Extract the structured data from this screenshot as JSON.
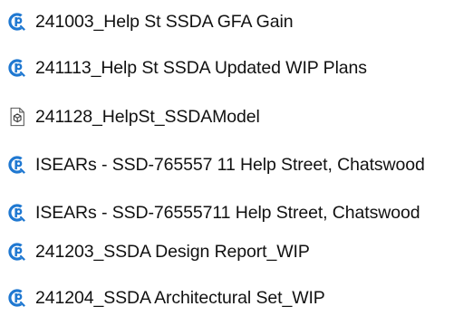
{
  "files": [
    {
      "name": "241003_Help St SSDA GFA Gain",
      "icon": "bluebeam-pdf-icon"
    },
    {
      "name": "241113_Help St SSDA Updated WIP Plans",
      "icon": "bluebeam-pdf-icon"
    },
    {
      "name": "241128_HelpSt_SSDAModel",
      "icon": "3d-model-file-icon"
    },
    {
      "name": "ISEARs - SSD-765557 11 Help Street, Chatswood",
      "icon": "bluebeam-pdf-icon"
    },
    {
      "name": "ISEARs - SSD-76555711 Help Street, Chatswood",
      "icon": "bluebeam-pdf-icon"
    },
    {
      "name": "241203_SSDA Design Report_WIP",
      "icon": "bluebeam-pdf-icon"
    },
    {
      "name": "241204_SSDA Architectural Set_WIP",
      "icon": "bluebeam-pdf-icon"
    }
  ],
  "colors": {
    "pdf_icon_blue": "#1F78D1",
    "text": "#111111",
    "background": "#FFFFFF"
  }
}
